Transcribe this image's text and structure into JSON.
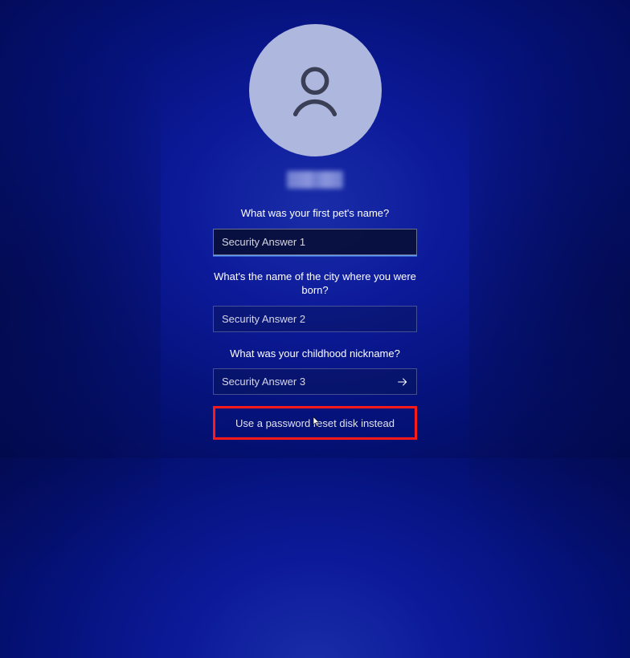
{
  "questions": {
    "q1": "What was your first pet's name?",
    "q2": "What's the name of the city where you were born?",
    "q3": "What was your childhood nickname?"
  },
  "placeholders": {
    "a1": "Security Answer 1",
    "a2": "Security Answer 2",
    "a3": "Security Answer 3"
  },
  "alt_link": "Use a password reset disk instead"
}
